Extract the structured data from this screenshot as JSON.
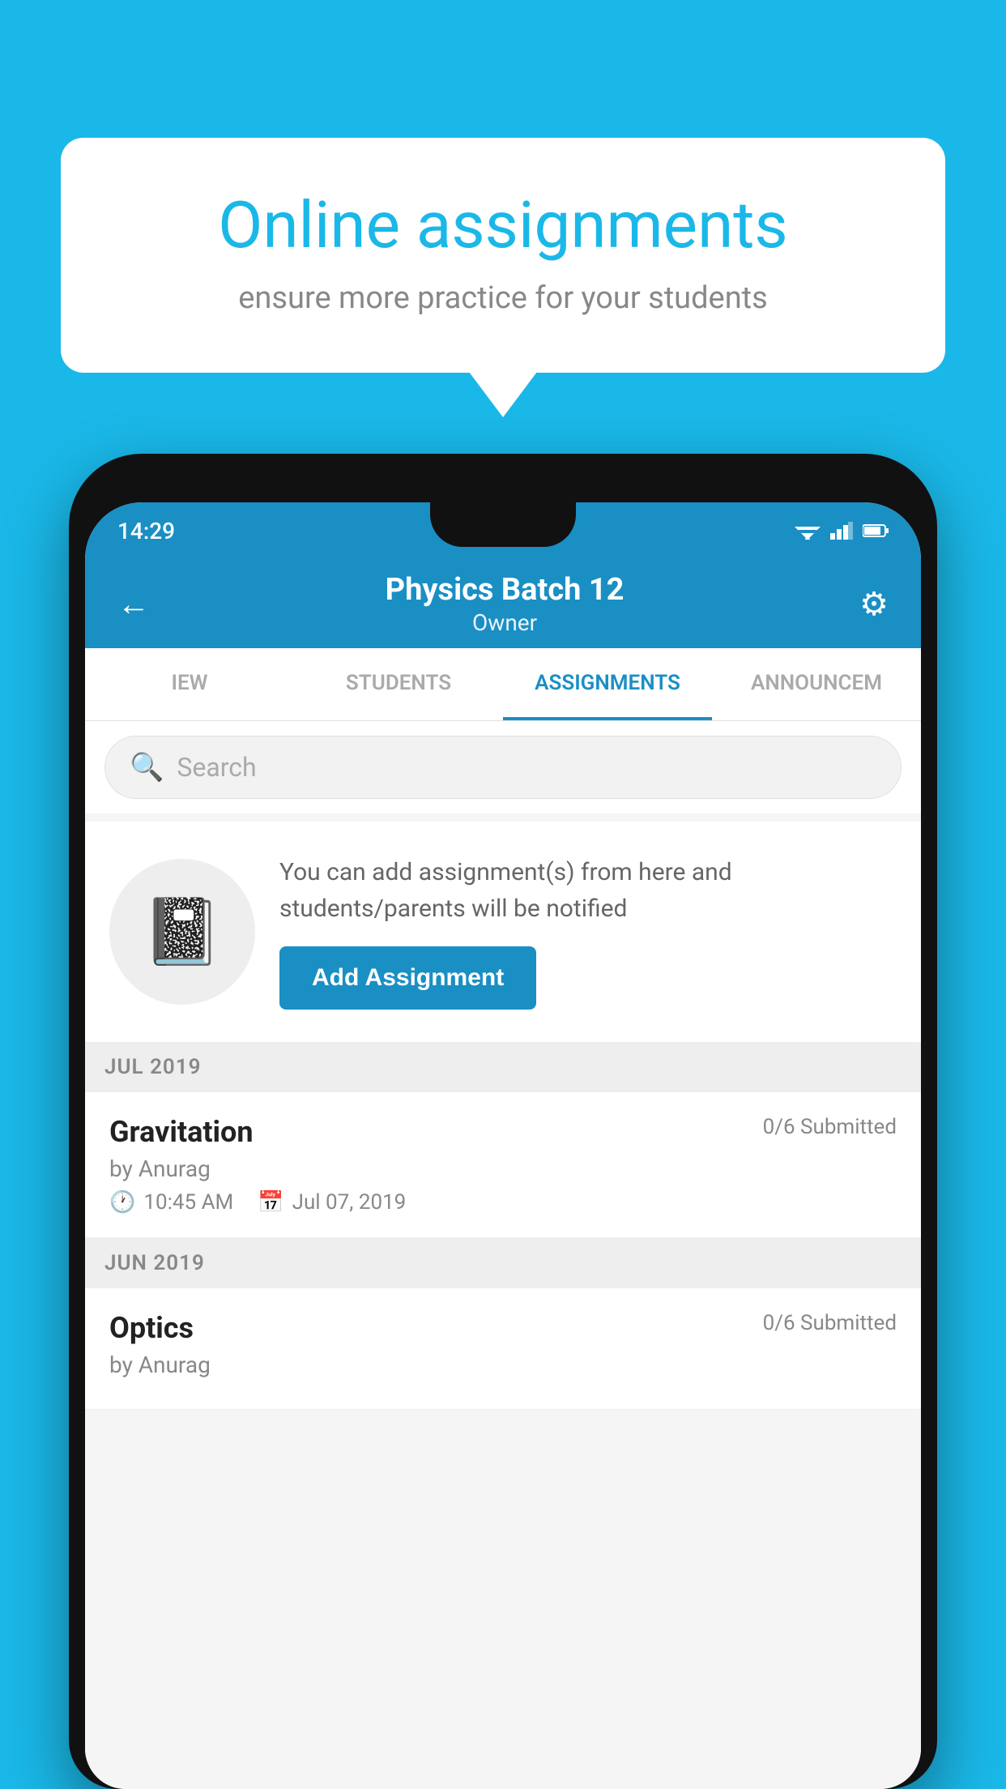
{
  "background": {
    "color": "#1ab8e8"
  },
  "speech_bubble": {
    "title": "Online assignments",
    "subtitle": "ensure more practice for your students"
  },
  "status_bar": {
    "time": "14:29"
  },
  "app_bar": {
    "title": "Physics Batch 12",
    "subtitle": "Owner",
    "back_label": "←",
    "settings_label": "⚙"
  },
  "tabs": [
    {
      "label": "IEW",
      "active": false
    },
    {
      "label": "STUDENTS",
      "active": false
    },
    {
      "label": "ASSIGNMENTS",
      "active": true
    },
    {
      "label": "ANNOUNCEM",
      "active": false
    }
  ],
  "search": {
    "placeholder": "Search"
  },
  "promo": {
    "text": "You can add assignment(s) from here and students/parents will be notified",
    "button_label": "Add Assignment"
  },
  "sections": [
    {
      "label": "JUL 2019",
      "assignments": [
        {
          "name": "Gravitation",
          "submitted": "0/6 Submitted",
          "author": "by Anurag",
          "time": "10:45 AM",
          "date": "Jul 07, 2019"
        }
      ]
    },
    {
      "label": "JUN 2019",
      "assignments": [
        {
          "name": "Optics",
          "submitted": "0/6 Submitted",
          "author": "by Anurag",
          "time": "",
          "date": ""
        }
      ]
    }
  ]
}
